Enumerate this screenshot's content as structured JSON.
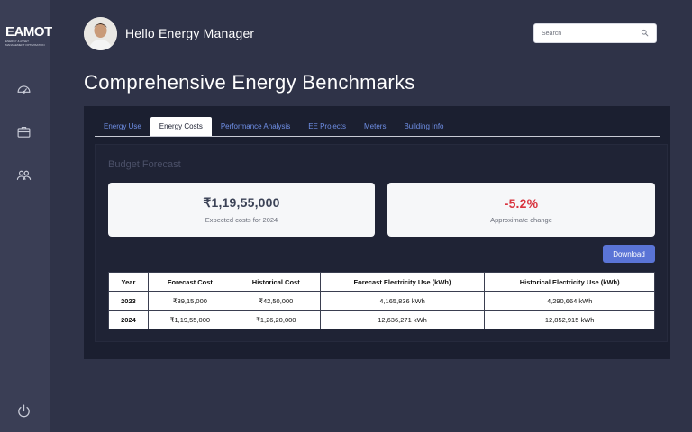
{
  "brand": {
    "logo_text": "EAMOT",
    "logo_subtitle": "ENERGY & ASSET MANAGEMENT OPTIMISATION"
  },
  "sidebar": {
    "items": [
      {
        "icon": "gauge-icon"
      },
      {
        "icon": "briefcase-icon"
      },
      {
        "icon": "users-icon"
      }
    ],
    "logout_icon": "power-icon"
  },
  "header": {
    "greeting": "Hello Energy Manager",
    "search_placeholder": "Search"
  },
  "page": {
    "title": "Comprehensive Energy Benchmarks"
  },
  "tabs": [
    {
      "label": "Energy Use",
      "active": false
    },
    {
      "label": "Energy Costs",
      "active": true
    },
    {
      "label": "Performance Analysis",
      "active": false
    },
    {
      "label": "EE Projects",
      "active": false
    },
    {
      "label": "Meters",
      "active": false
    },
    {
      "label": "Building Info",
      "active": false
    }
  ],
  "budget": {
    "section_title": "Budget Forecast",
    "expected_cost_value": "₹1,19,55,000",
    "expected_cost_label": "Expected costs for 2024",
    "change_value": "-5.2%",
    "change_label": "Approximate change",
    "download_label": "Download"
  },
  "table": {
    "headers": [
      "Year",
      "Forecast Cost",
      "Historical Cost",
      "Forecast Electricity Use (kWh)",
      "Historical Electricity Use (kWh)"
    ],
    "rows": [
      [
        "2023",
        "₹39,15,000",
        "₹42,50,000",
        "4,165,836 kWh",
        "4,290,664 kWh"
      ],
      [
        "2024",
        "₹1,19,55,000",
        "₹1,26,20,000",
        "12,636,271 kWh",
        "12,852,915 kWh"
      ]
    ]
  },
  "colors": {
    "background": "#2f3348",
    "sidebar": "#3a3e55",
    "panel": "#1b1f30",
    "accent": "#5a74d6",
    "tab_link": "#6f8fe6",
    "negative": "#d9343f",
    "cost_value": "#3b4256"
  }
}
